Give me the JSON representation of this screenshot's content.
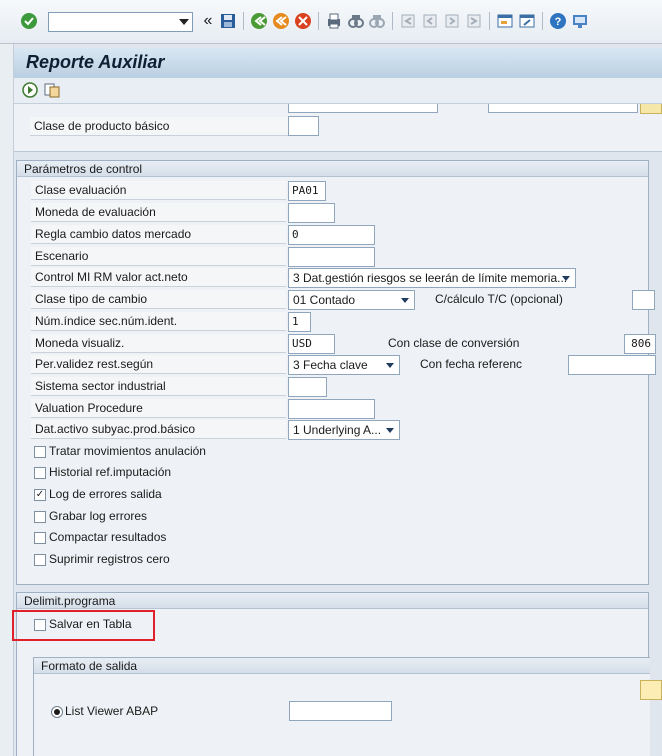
{
  "toolbar": {
    "icons": [
      "enter-icon",
      "save-icon",
      "back-icon",
      "exit-icon",
      "cancel-icon",
      "print-icon",
      "find-icon",
      "find-next-icon",
      "first-page-icon",
      "previous-page-icon",
      "next-page-icon",
      "last-page-icon",
      "new-session-icon",
      "shortcut-icon",
      "help-icon",
      "customize-layout-icon"
    ],
    "command_field_value": ""
  },
  "title": "Reporte Auxiliar",
  "app_toolbar": {
    "icons": [
      "execute-icon",
      "get-variant-icon"
    ]
  },
  "top_section": {
    "clase_producto_label": "Clase de producto básico",
    "clase_producto_value": ""
  },
  "parametros": {
    "title": "Parámetros de control",
    "rows": {
      "clase_evaluacion": {
        "label": "Clase evaluación",
        "value": "PA01"
      },
      "moneda_evaluacion": {
        "label": "Moneda de evaluación",
        "value": ""
      },
      "regla_cambio": {
        "label": "Regla cambio datos mercado",
        "value": "0"
      },
      "escenario": {
        "label": "Escenario",
        "value": ""
      },
      "control_mi": {
        "label": "Control MI RM valor act.neto",
        "value": "3 Dat.gestión riesgos se leerán de límite memoria..."
      },
      "clase_tipo_cambio": {
        "label": "Clase tipo de cambio",
        "value": "01 Contado",
        "extra_label": "C/cálculo T/C (opcional)",
        "extra_value": ""
      },
      "num_indice": {
        "label": "Núm.índice sec.núm.ident.",
        "value": "1"
      },
      "moneda_visualiz": {
        "label": "Moneda visualiz.",
        "value": "USD",
        "extra_label": "Con clase de conversión",
        "extra_value": "806"
      },
      "per_validez": {
        "label": "Per.validez rest.según",
        "value": "3 Fecha clave",
        "extra_label": "Con fecha referenc",
        "extra_value": ""
      },
      "sistema_sector": {
        "label": "Sistema sector industrial",
        "value": ""
      },
      "valuation_procedure": {
        "label": "Valuation Procedure",
        "value": ""
      },
      "dat_activo": {
        "label": "Dat.activo subyac.prod.básico",
        "value": "1 Underlying A..."
      }
    },
    "checkboxes": [
      {
        "label": "Tratar movimientos anulación",
        "checked": false
      },
      {
        "label": "Historial ref.imputación",
        "checked": false
      },
      {
        "label": "Log de errores salida",
        "checked": true
      },
      {
        "label": "Grabar log errores",
        "checked": false
      },
      {
        "label": "Compactar resultados",
        "checked": false
      },
      {
        "label": "Suprimir registros cero",
        "checked": false
      }
    ]
  },
  "delimit": {
    "title": "Delimit.programa",
    "salvar_label": "Salvar en Tabla",
    "salvar_checked": false
  },
  "formato": {
    "title": "Formato de salida",
    "list_viewer_label": "List Viewer ABAP",
    "list_viewer_value": ""
  },
  "colors": {
    "highlight": "#e0202a",
    "title_bg": "#c9dbea"
  }
}
